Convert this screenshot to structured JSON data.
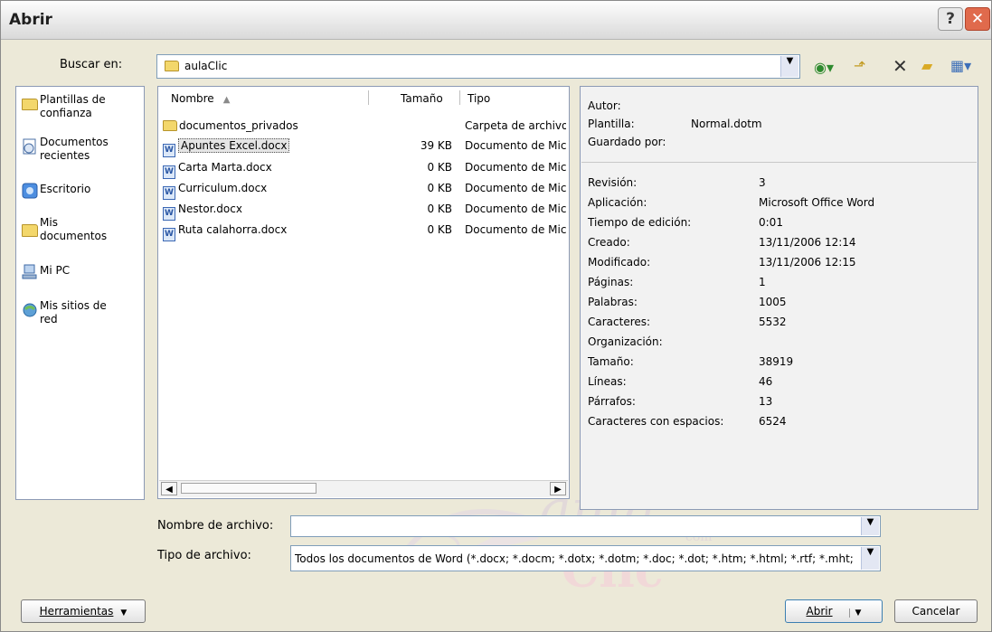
{
  "window": {
    "title": "Abrir",
    "help_label": "?",
    "close_label": "✕"
  },
  "look_in": {
    "label": "Buscar en:",
    "value": "aulaClic"
  },
  "toolbar": {
    "icons": [
      "back-icon",
      "up-folder-icon",
      "delete-icon",
      "new-folder-icon",
      "views-icon"
    ]
  },
  "places": [
    {
      "label": "Plantillas de\nconfianza",
      "icon": "folder-icon"
    },
    {
      "label": "Documentos\nrecientes",
      "icon": "recent-documents-icon"
    },
    {
      "label": "Escritorio",
      "icon": "desktop-icon"
    },
    {
      "label": "Mis\ndocumentos",
      "icon": "my-documents-icon"
    },
    {
      "label": "Mi PC",
      "icon": "my-computer-icon"
    },
    {
      "label": "Mis sitios de\nred",
      "icon": "network-places-icon"
    }
  ],
  "files": {
    "columns": [
      "Nombre",
      "Tamaño",
      "Tipo"
    ],
    "rows": [
      {
        "name": "documentos_privados",
        "size": "",
        "type": "Carpeta de archivos",
        "icon": "folder-icon"
      },
      {
        "name": "Apuntes Excel.docx",
        "size": "39 KB",
        "type": "Documento de Microsoft Office Word",
        "icon": "word-document-icon",
        "selected": true
      },
      {
        "name": "Carta Marta.docx",
        "size": "0 KB",
        "type": "Documento de Microsoft Office Word",
        "icon": "word-document-icon"
      },
      {
        "name": "Curriculum.docx",
        "size": "0 KB",
        "type": "Documento de Microsoft Office Word",
        "icon": "word-document-icon"
      },
      {
        "name": "Nestor.docx",
        "size": "0 KB",
        "type": "Documento de Microsoft Office Word",
        "icon": "word-document-icon"
      },
      {
        "name": "Ruta calahorra.docx",
        "size": "0 KB",
        "type": "Documento de Microsoft Office Word",
        "icon": "word-document-icon"
      }
    ]
  },
  "properties": {
    "top": [
      {
        "label": "Autor:",
        "value": ""
      },
      {
        "label": "Plantilla:",
        "value": "Normal.dotm"
      },
      {
        "label": "Guardado por:",
        "value": ""
      }
    ],
    "details": [
      {
        "label": "Revisión:",
        "value": "3"
      },
      {
        "label": "Aplicación:",
        "value": "Microsoft Office Word"
      },
      {
        "label": "Tiempo de edición:",
        "value": "0:01"
      },
      {
        "label": "Creado:",
        "value": "13/11/2006 12:14"
      },
      {
        "label": "Modificado:",
        "value": "13/11/2006 12:15"
      },
      {
        "label": "Páginas:",
        "value": "1"
      },
      {
        "label": "Palabras:",
        "value": "1005"
      },
      {
        "label": "Caracteres:",
        "value": "5532"
      },
      {
        "label": "Organización:",
        "value": ""
      },
      {
        "label": "Tamaño:",
        "value": "38919"
      },
      {
        "label": "Líneas:",
        "value": "46"
      },
      {
        "label": "Párrafos:",
        "value": "13"
      },
      {
        "label": "Caracteres con espacios:",
        "value": "6524"
      }
    ]
  },
  "filename": {
    "label": "Nombre de archivo:",
    "value": ""
  },
  "filetype": {
    "label": "Tipo de archivo:",
    "value": "Todos los documentos de Word (*.docx; *.docm; *.dotx; *.dotm; *.doc; *.dot; *.htm; *.html; *.rtf; *.mht; *.mhtml; *.xml)"
  },
  "buttons": {
    "tools": "Herramientas",
    "open": "Abrir",
    "cancel": "Cancelar"
  },
  "watermark": {
    "line1": "aula",
    "line2": "com",
    "line3": "Clic"
  }
}
